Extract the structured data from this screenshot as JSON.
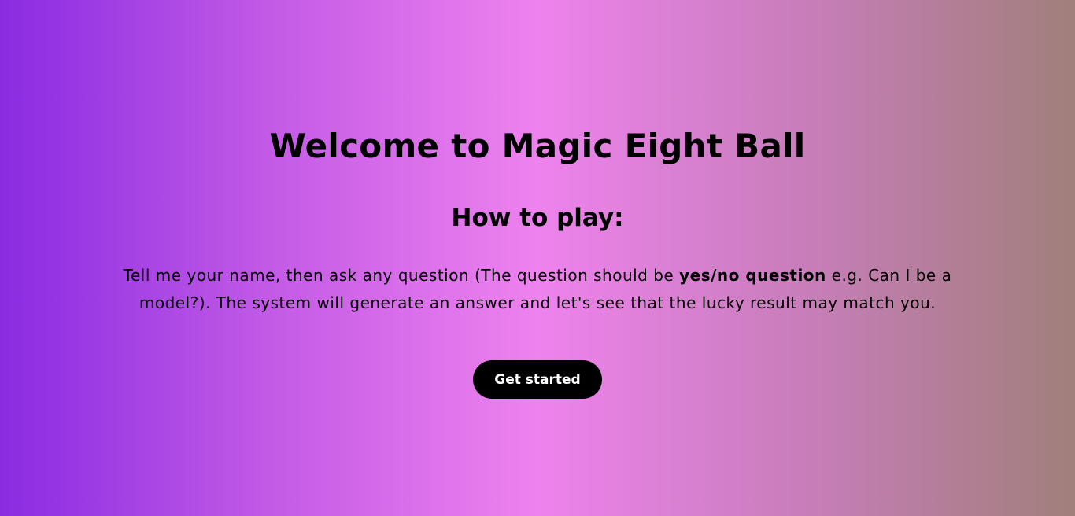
{
  "page": {
    "title": "Welcome to Magic Eight Ball",
    "subtitle": "How to play:",
    "description": {
      "before": "Tell me your name, then ask any question (The question should be ",
      "emphasis": "yes/no question",
      "after": " e.g. Can I be a model?). The system will generate an answer and let's see that the lucky result may match you."
    },
    "button_label": "Get started"
  },
  "colors": {
    "gradient_left": "#8a2be2",
    "gradient_middle": "#ee82ee",
    "gradient_right": "#a17f7a",
    "button_background": "#000000",
    "button_text": "#ffffff",
    "text": "#000000"
  }
}
